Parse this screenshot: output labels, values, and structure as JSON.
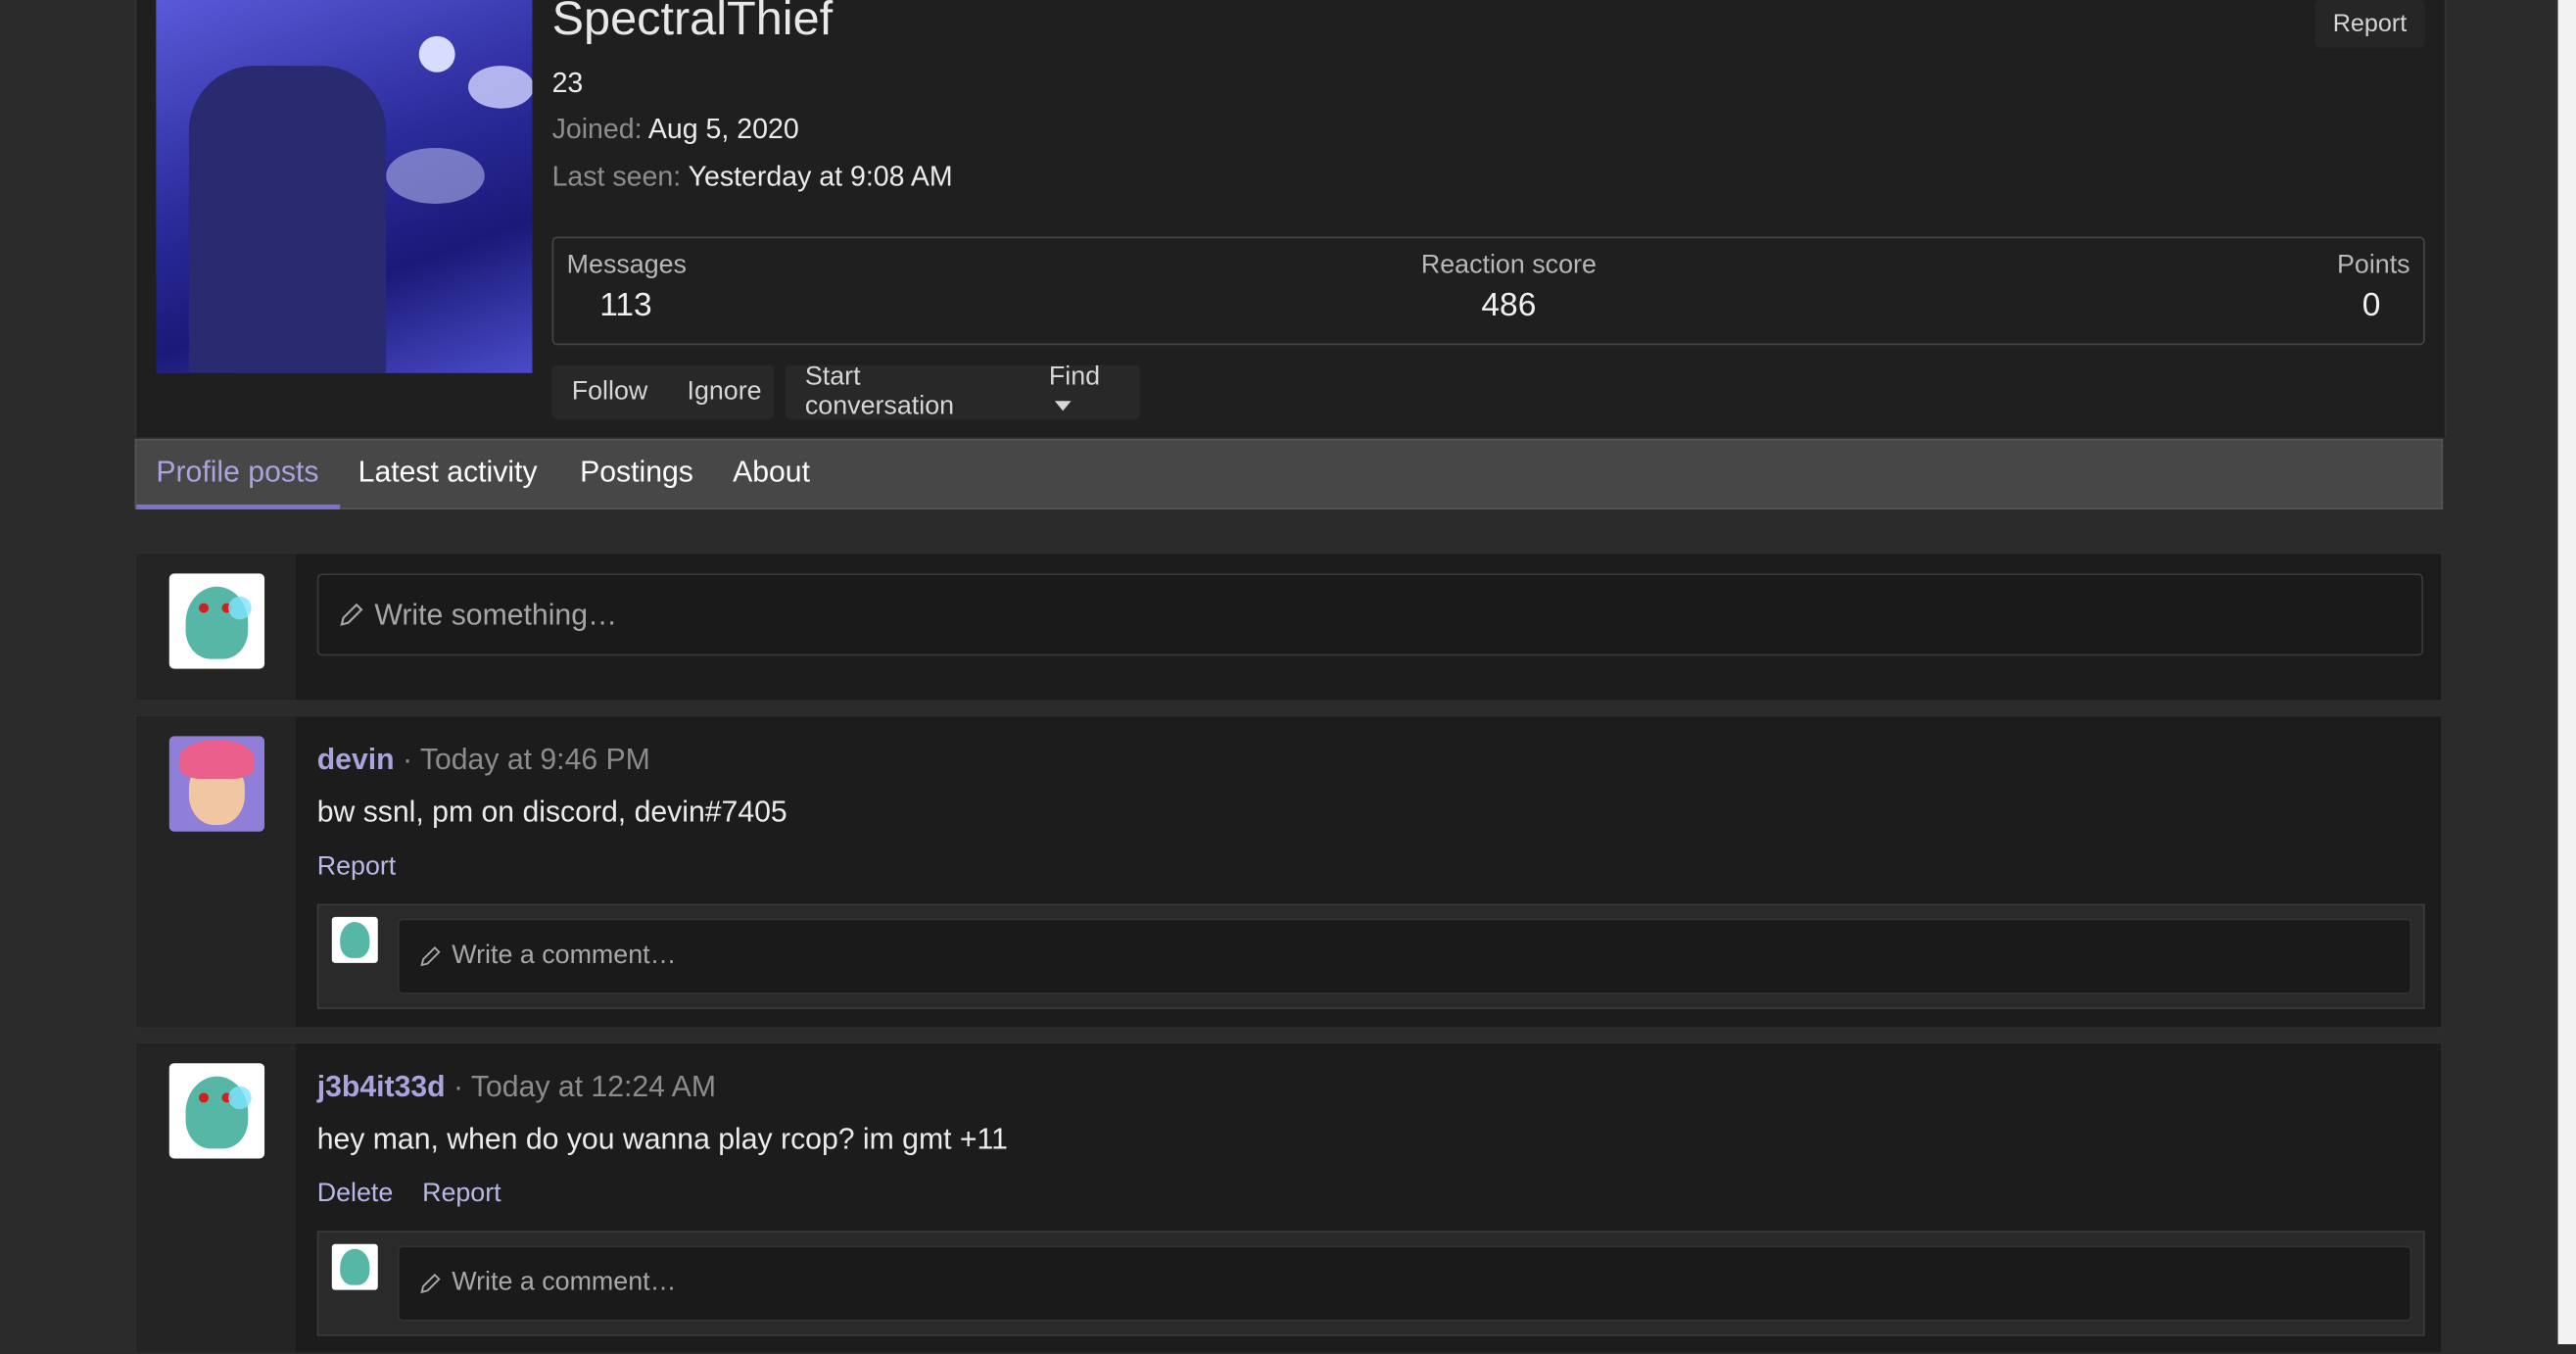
{
  "profile": {
    "username": "SpectralThief",
    "age": "23",
    "joined_label": "Joined:",
    "joined_value": "Aug 5, 2020",
    "lastseen_label": "Last seen:",
    "lastseen_value": "Yesterday at 9:08 AM",
    "report_label": "Report"
  },
  "stats": {
    "messages_label": "Messages",
    "messages_value": "113",
    "reaction_label": "Reaction score",
    "reaction_value": "486",
    "points_label": "Points",
    "points_value": "0"
  },
  "actions": {
    "follow": "Follow",
    "ignore": "Ignore",
    "start_conversation": "Start conversation",
    "find": "Find"
  },
  "tabs": [
    {
      "label": "Profile posts",
      "active": true
    },
    {
      "label": "Latest activity"
    },
    {
      "label": "Postings"
    },
    {
      "label": "About"
    }
  ],
  "composer": {
    "placeholder": "Write something…"
  },
  "posts": [
    {
      "author": "devin",
      "time": "Today at 9:46 PM",
      "text": "bw ssnl, pm on discord, devin#7405",
      "actions": [
        "Report"
      ],
      "comment_placeholder": "Write a comment…"
    },
    {
      "author": "j3b4it33d",
      "time": "Today at 12:24 AM",
      "text": "hey man, when do you wanna play rcop? im gmt +11",
      "actions": [
        "Delete",
        "Report"
      ],
      "comment_placeholder": "Write a comment…"
    }
  ],
  "separator": " · ",
  "icons": [
    "pencil-icon",
    "caret-down-icon"
  ],
  "colors": {
    "accent": "#a9a4dd",
    "background": "#2b2b2b",
    "panel": "#1f1f1f"
  }
}
